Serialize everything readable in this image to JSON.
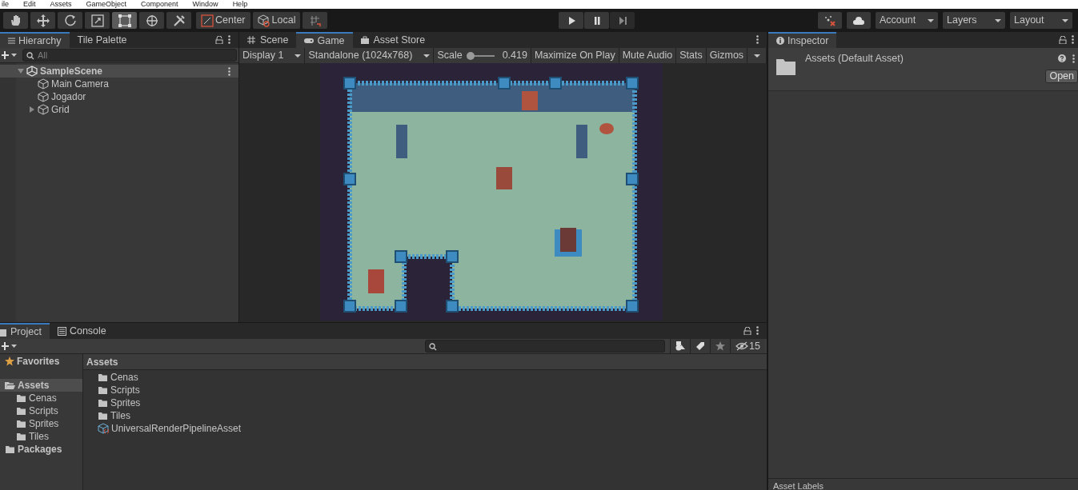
{
  "menu_bar": [
    "ile",
    "Edit",
    "Assets",
    "GameObject",
    "Component",
    "Window",
    "Help"
  ],
  "toolbar": {
    "tools": [
      {
        "kind": "hand",
        "selected": false
      },
      {
        "kind": "move",
        "selected": false
      },
      {
        "kind": "rotate",
        "selected": false
      },
      {
        "kind": "scale",
        "selected": false
      },
      {
        "kind": "rect",
        "selected": true
      },
      {
        "kind": "transform",
        "selected": false
      },
      {
        "kind": "custom",
        "selected": false
      }
    ],
    "pivot": "Center",
    "space": "Local",
    "playback": [
      {
        "kind": "play"
      },
      {
        "kind": "pause"
      },
      {
        "kind": "step"
      }
    ],
    "menus": [
      "Account",
      "Layers",
      "Layout"
    ]
  },
  "hierarchy": {
    "tabs": [
      {
        "label": "Hierarchy",
        "selected": true
      },
      {
        "label": "Tile Palette",
        "selected": false
      }
    ],
    "search": {
      "placeholder": "All"
    },
    "tree": [
      {
        "label": "SampleScene",
        "kind": "scene",
        "expanded": true,
        "children": [
          {
            "label": "Main Camera",
            "kind": "object"
          },
          {
            "label": "Jogador",
            "kind": "object"
          },
          {
            "label": "Grid",
            "kind": "object",
            "expanded": false
          }
        ]
      }
    ]
  },
  "game": {
    "tabs": [
      {
        "label": "Scene",
        "kind": "scene",
        "selected": false
      },
      {
        "label": "Game",
        "kind": "game",
        "selected": true
      },
      {
        "label": "Asset Store",
        "kind": "store",
        "selected": false
      }
    ],
    "display": "Display 1",
    "resolution": "Standalone (1024x768)",
    "scale_label": "Scale",
    "scale": {
      "level": 0.0
    },
    "scale_reading": "0.419",
    "buttons": [
      "Maximize On Play",
      "Mute Audio",
      "Stats",
      "Gizmos"
    ]
  },
  "inspector": {
    "tab": "Inspector",
    "title": "Assets (Default Asset)",
    "open_button": "Open",
    "footer": "Asset Labels"
  },
  "project": {
    "tabs": [
      {
        "label": "Project",
        "selected": true
      },
      {
        "label": "Console",
        "selected": false
      }
    ],
    "hidden_count": "15",
    "sidebar": [
      {
        "label": "Favorites",
        "kind": "favorites",
        "selected": false
      },
      {
        "label": "Assets",
        "kind": "folder",
        "selected": true,
        "children": [
          {
            "label": "Cenas",
            "kind": "folder",
            "selected": false
          },
          {
            "label": "Scripts",
            "kind": "folder",
            "selected": false
          },
          {
            "label": "Sprites",
            "kind": "folder",
            "selected": false
          },
          {
            "label": "Tiles",
            "kind": "folder",
            "selected": false
          }
        ]
      },
      {
        "label": "Packages",
        "kind": "folder",
        "selected": false
      }
    ],
    "breadcrumb": "Assets",
    "items": [
      {
        "label": "Cenas",
        "kind": "folder"
      },
      {
        "label": "Scripts",
        "kind": "folder"
      },
      {
        "label": "Sprites",
        "kind": "folder"
      },
      {
        "label": "Tiles",
        "kind": "folder"
      },
      {
        "label": "UniversalRenderPipelineAsset",
        "kind": "asset"
      }
    ]
  }
}
